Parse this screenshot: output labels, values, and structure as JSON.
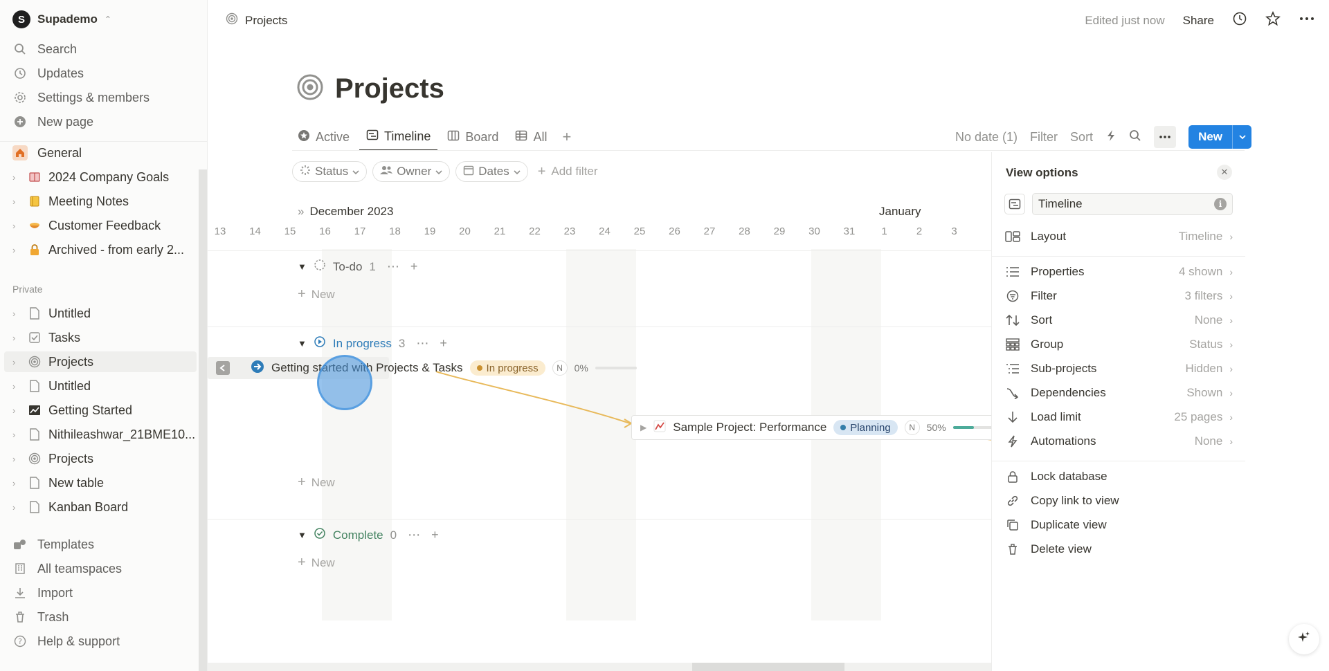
{
  "workspace": {
    "name": "Supademo",
    "initial": "S"
  },
  "sidebar": {
    "nav": [
      {
        "label": "Search",
        "icon": "search-icon"
      },
      {
        "label": "Updates",
        "icon": "clock-icon"
      },
      {
        "label": "Settings & members",
        "icon": "gear-icon"
      },
      {
        "label": "New page",
        "icon": "plus-circle-icon"
      }
    ],
    "teamspace": "General",
    "team_pages": [
      {
        "label": "2024 Company Goals",
        "icon": "book-icon"
      },
      {
        "label": "Meeting Notes",
        "icon": "notebook-icon"
      },
      {
        "label": "Customer Feedback",
        "icon": "bowl-icon"
      },
      {
        "label": "Archived - from early 2...",
        "icon": "lock-icon"
      }
    ],
    "private_label": "Private",
    "private_pages": [
      {
        "label": "Untitled",
        "icon": "page-icon"
      },
      {
        "label": "Tasks",
        "icon": "checkbox-icon"
      },
      {
        "label": "Projects",
        "icon": "target-icon",
        "active": true
      },
      {
        "label": "Untitled",
        "icon": "page-icon"
      },
      {
        "label": "Getting Started",
        "icon": "chart-icon"
      },
      {
        "label": "Nithileashwar_21BME10...",
        "icon": "page-icon"
      },
      {
        "label": "Projects",
        "icon": "target-icon"
      },
      {
        "label": "New table",
        "icon": "page-icon"
      },
      {
        "label": "Kanban Board",
        "icon": "page-icon"
      }
    ],
    "bottom": [
      {
        "label": "Templates",
        "icon": "templates-icon"
      },
      {
        "label": "All teamspaces",
        "icon": "building-icon"
      },
      {
        "label": "Import",
        "icon": "download-icon"
      },
      {
        "label": "Trash",
        "icon": "trash-icon"
      },
      {
        "label": "Help & support",
        "icon": "question-icon"
      }
    ]
  },
  "topbar": {
    "breadcrumb": "Projects",
    "edited": "Edited just now",
    "share": "Share"
  },
  "page": {
    "title": "Projects",
    "tabs": [
      {
        "label": "Active",
        "icon": "star-circle-icon"
      },
      {
        "label": "Timeline",
        "icon": "timeline-icon",
        "selected": true
      },
      {
        "label": "Board",
        "icon": "board-icon"
      },
      {
        "label": "All",
        "icon": "table-icon"
      }
    ],
    "toolbar": {
      "no_date": "No date (1)",
      "filter": "Filter",
      "sort": "Sort",
      "new": "New"
    },
    "filters": [
      {
        "label": "Status",
        "icon": "status-icon"
      },
      {
        "label": "Owner",
        "icon": "people-icon"
      },
      {
        "label": "Dates",
        "icon": "calendar-icon"
      }
    ],
    "add_filter": "Add filter"
  },
  "timeline": {
    "month1": "December 2023",
    "month2": "January",
    "days": [
      "13",
      "14",
      "15",
      "16",
      "17",
      "18",
      "19",
      "20",
      "21",
      "22",
      "23",
      "24",
      "25",
      "26",
      "27",
      "28",
      "29",
      "30",
      "31",
      "1",
      "2",
      "3"
    ],
    "groups": [
      {
        "label": "To-do",
        "count": "1",
        "color": "#787774"
      },
      {
        "label": "In progress",
        "count": "3",
        "color": "#2e7cb8"
      },
      {
        "label": "Complete",
        "count": "0",
        "color": "#448361"
      }
    ],
    "new_label": "New",
    "tasks": [
      {
        "title": "Getting started with Projects & Tasks",
        "status": "In progress",
        "status_bg": "#fbeccf",
        "status_dot": "#cb912f",
        "owner": "N",
        "progress_text": "0%",
        "progress": 0
      },
      {
        "title": "Sample Project: Performance",
        "status": "Planning",
        "status_bg": "#d8e6f3",
        "status_dot": "#337ea9",
        "owner": "N",
        "progress_text": "50%",
        "progress": 0.5
      }
    ]
  },
  "view_options": {
    "title": "View options",
    "view_name": "Timeline",
    "rows": [
      {
        "label": "Layout",
        "value": "Timeline",
        "icon": "layout-icon"
      },
      {
        "label": "Properties",
        "value": "4 shown",
        "icon": "list-icon"
      },
      {
        "label": "Filter",
        "value": "3 filters",
        "icon": "filter-icon"
      },
      {
        "label": "Sort",
        "value": "None",
        "icon": "sort-icon"
      },
      {
        "label": "Group",
        "value": "Status",
        "icon": "group-icon"
      },
      {
        "label": "Sub-projects",
        "value": "Hidden",
        "icon": "subitems-icon"
      },
      {
        "label": "Dependencies",
        "value": "Shown",
        "icon": "dependency-icon"
      },
      {
        "label": "Load limit",
        "value": "25 pages",
        "icon": "arrow-down-icon"
      },
      {
        "label": "Automations",
        "value": "None",
        "icon": "lightning-icon"
      }
    ],
    "actions": [
      {
        "label": "Lock database",
        "icon": "lock-icon"
      },
      {
        "label": "Copy link to view",
        "icon": "link-icon"
      },
      {
        "label": "Duplicate view",
        "icon": "duplicate-icon"
      },
      {
        "label": "Delete view",
        "icon": "trash-icon"
      }
    ]
  }
}
